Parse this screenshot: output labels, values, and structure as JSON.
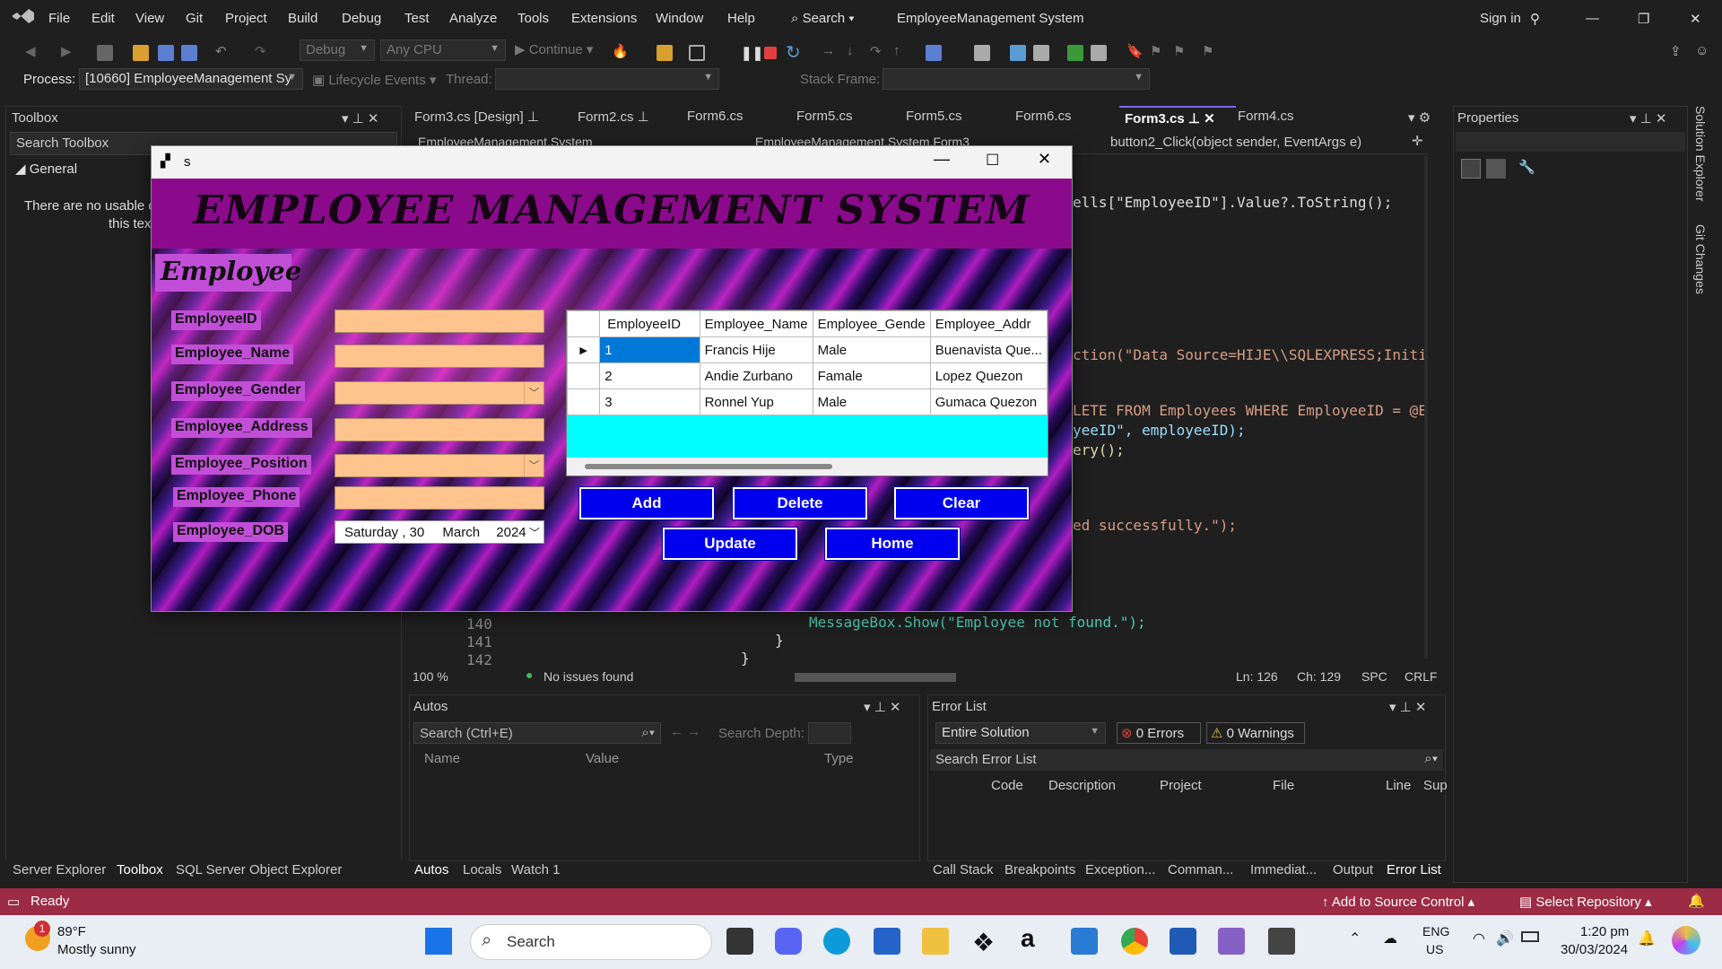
{
  "menu": [
    "File",
    "Edit",
    "View",
    "Git",
    "Project",
    "Build",
    "Debug",
    "Test",
    "Analyze",
    "Tools",
    "Extensions",
    "Window",
    "Help"
  ],
  "search_label": "Search",
  "window_title": "EmployeeManagement System",
  "sign_in": "Sign in",
  "toolbar": {
    "config": "Debug",
    "platform": "Any CPU",
    "continue": "Continue",
    "process_label": "Process:",
    "process_value": "[10660] EmployeeManagement Sy",
    "lifecycle": "Lifecycle Events",
    "thread_label": "Thread:",
    "stack_label": "Stack Frame:"
  },
  "toolbox": {
    "title": "Toolbox",
    "search": "Search Toolbox",
    "group": "General",
    "empty_line1": "There are no usable c",
    "empty_line2": "this tex"
  },
  "tabs": [
    {
      "label": "Form3.cs [Design]"
    },
    {
      "label": "Form2.cs"
    },
    {
      "label": "Form6.cs"
    },
    {
      "label": "Form5.cs"
    },
    {
      "label": "Form5.cs"
    },
    {
      "label": "Form6.cs"
    },
    {
      "label": "Form3.cs"
    },
    {
      "label": "Form4.cs"
    }
  ],
  "nav": {
    "project": "EmployeeManagement.System",
    "class": "EmployeeManagement.System.Form3",
    "member": "button2_Click(object sender, EventArgs e)"
  },
  "code": {
    "l1": "ells[\"EmployeeID\"].Value?.ToString();",
    "l2": "ction(\"Data Source=HIJE\\\\SQLEXPRESS;Initi",
    "l3": "LETE FROM Employees WHERE EmployeeID = @E",
    "l4": "yeeID\", employeeID);",
    "l5": "ery();",
    "l6": "ed successfully.\");",
    "l7": "MessageBox.Show(\"Employee not found.\");",
    "l8": "}",
    "l9": "}",
    "ln140": "140",
    "ln141": "141",
    "ln142": "142"
  },
  "editor_status": {
    "zoom": "100 %",
    "issues": "No issues found",
    "ln": "Ln: 126",
    "ch": "Ch: 129",
    "spc": "SPC",
    "crlf": "CRLF"
  },
  "properties": {
    "title": "Properties"
  },
  "side_tabs": [
    "Solution Explorer",
    "Git Changes"
  ],
  "autos": {
    "title": "Autos",
    "search": "Search (Ctrl+E)",
    "depth": "Search Depth:",
    "cols": [
      "Name",
      "Value",
      "Type"
    ],
    "tabs": [
      "Autos",
      "Locals",
      "Watch 1"
    ]
  },
  "errors": {
    "title": "Error List",
    "scope": "Entire Solution",
    "err": "0 Errors",
    "warn": "0 Warnings",
    "search": "Search Error List",
    "cols": [
      "Code",
      "Description",
      "Project",
      "File",
      "Line",
      "Sup"
    ],
    "tabs": [
      "Call Stack",
      "Breakpoints",
      "Exception...",
      "Comman...",
      "Immediat...",
      "Output",
      "Error List"
    ]
  },
  "left_bottom_tabs": [
    "Server Explorer",
    "Toolbox",
    "SQL Server Object Explorer"
  ],
  "status": {
    "ready": "Ready",
    "source": "Add to Source Control",
    "repo": "Select Repository"
  },
  "form": {
    "title": "s",
    "banner": "EMPLOYEE MANAGEMENT SYSTEM",
    "section": "Employee",
    "labels": {
      "id": "EmployeeID",
      "name": "Employee_Name",
      "gender": "Employee_Gender",
      "address": "Employee_Address",
      "position": "Employee_Position",
      "phone": "Employee_Phone",
      "dob": "Employee_DOB"
    },
    "dob_value": {
      "day_name": "Saturday",
      "day": ", 30",
      "month": "March",
      "year": "2024"
    },
    "grid": {
      "headers": [
        "EmployeeID",
        "Employee_Name",
        "Employee_Gende",
        "Employee_Addr"
      ],
      "rows": [
        [
          "1",
          "Francis Hije",
          "Male",
          "Buenavista Que..."
        ],
        [
          "2",
          "Andie Zurbano",
          "Famale",
          "Lopez Quezon"
        ],
        [
          "3",
          "Ronnel Yup",
          "Male",
          "Gumaca Quezon"
        ]
      ]
    },
    "buttons": {
      "add": "Add",
      "delete": "Delete",
      "clear": "Clear",
      "update": "Update",
      "home": "Home"
    }
  },
  "taskbar": {
    "temp": "89°F",
    "weather": "Mostly sunny",
    "badge": "1",
    "search": "Search",
    "lang1": "ENG",
    "lang2": "US",
    "time": "1:20 pm",
    "date": "30/03/2024"
  }
}
